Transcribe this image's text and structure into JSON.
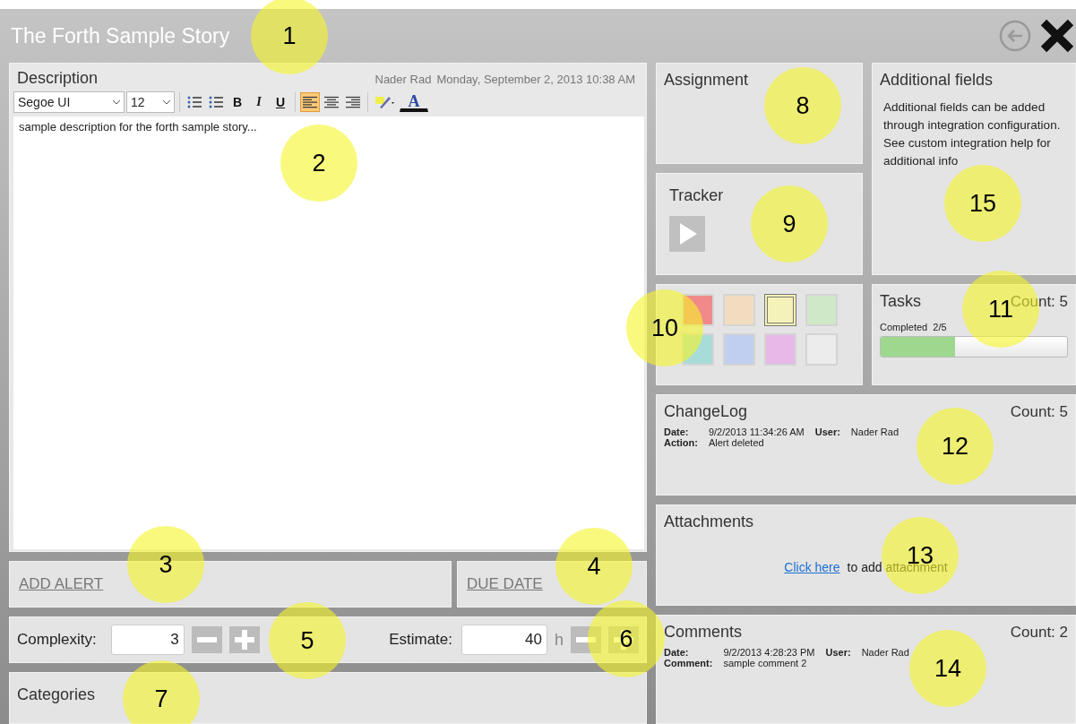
{
  "window": {
    "title": "The Forth Sample Story"
  },
  "description": {
    "heading": "Description",
    "author": "Nader Rad",
    "timestamp": "Monday, September 2, 2013 10:38 AM",
    "font": "Segoe UI",
    "size": "12",
    "text": "sample description for the forth sample story...",
    "toolbar": [
      {
        "kind": "bullets",
        "selected": false
      },
      {
        "kind": "numbers",
        "selected": false
      },
      {
        "kind": "bold",
        "label": "B",
        "selected": false
      },
      {
        "kind": "italic",
        "label": "I",
        "selected": false
      },
      {
        "kind": "underline",
        "label": "U",
        "selected": false
      },
      {
        "kind": "align-left",
        "selected": true
      },
      {
        "kind": "align-center",
        "selected": false
      },
      {
        "kind": "align-right",
        "selected": false
      },
      {
        "kind": "highlight",
        "selected": false
      },
      {
        "kind": "font-color",
        "label": "A",
        "selected": false
      }
    ]
  },
  "add_alert": "ADD ALERT",
  "due_date": "DUE DATE",
  "complexity": {
    "label": "Complexity:",
    "value": "3"
  },
  "estimate": {
    "label": "Estimate:",
    "value": "40",
    "unit": "h"
  },
  "categories": {
    "heading": "Categories"
  },
  "assignment": {
    "heading": "Assignment"
  },
  "tracker": {
    "heading": "Tracker"
  },
  "colors": [
    {
      "color": "#f08a8a",
      "selected": false
    },
    {
      "color": "#f2dcc0",
      "selected": false
    },
    {
      "color": "#f4f2b8",
      "selected": true
    },
    {
      "color": "#cfe8c8",
      "selected": false
    },
    {
      "color": "#a8dcd8",
      "selected": false
    },
    {
      "color": "#c0cff0",
      "selected": false
    },
    {
      "color": "#e8b8e8",
      "selected": false
    },
    {
      "color": "#ececec",
      "selected": false
    }
  ],
  "additional_fields": {
    "heading": "Additional fields",
    "text": "Additional fields can be added through integration configuration. See custom integration help for additional info"
  },
  "tasks": {
    "heading": "Tasks",
    "count": "Count: 5",
    "completed": "Completed  2/5",
    "level": 0.4
  },
  "changelog": {
    "heading": "ChangeLog",
    "count": "Count: 5",
    "date_label": "Date:",
    "date": "9/2/2013 11:34:26 AM",
    "user_label": "User:",
    "user": "Nader Rad",
    "action_label": "Action:",
    "action": "Alert deleted"
  },
  "attachments": {
    "heading": "Attachments",
    "link": "Click here",
    "text": "to add attachment"
  },
  "comments": {
    "heading": "Comments",
    "count": "Count: 2",
    "date_label": "Date:",
    "date": "9/2/2013 4:28:23 PM",
    "user_label": "User:",
    "user": "Nader Rad",
    "comment_label": "Comment:",
    "comment": "sample comment 2"
  },
  "callouts": [
    "1",
    "2",
    "3",
    "4",
    "5",
    "6",
    "7",
    "8",
    "9",
    "10",
    "11",
    "12",
    "13",
    "14",
    "15"
  ]
}
